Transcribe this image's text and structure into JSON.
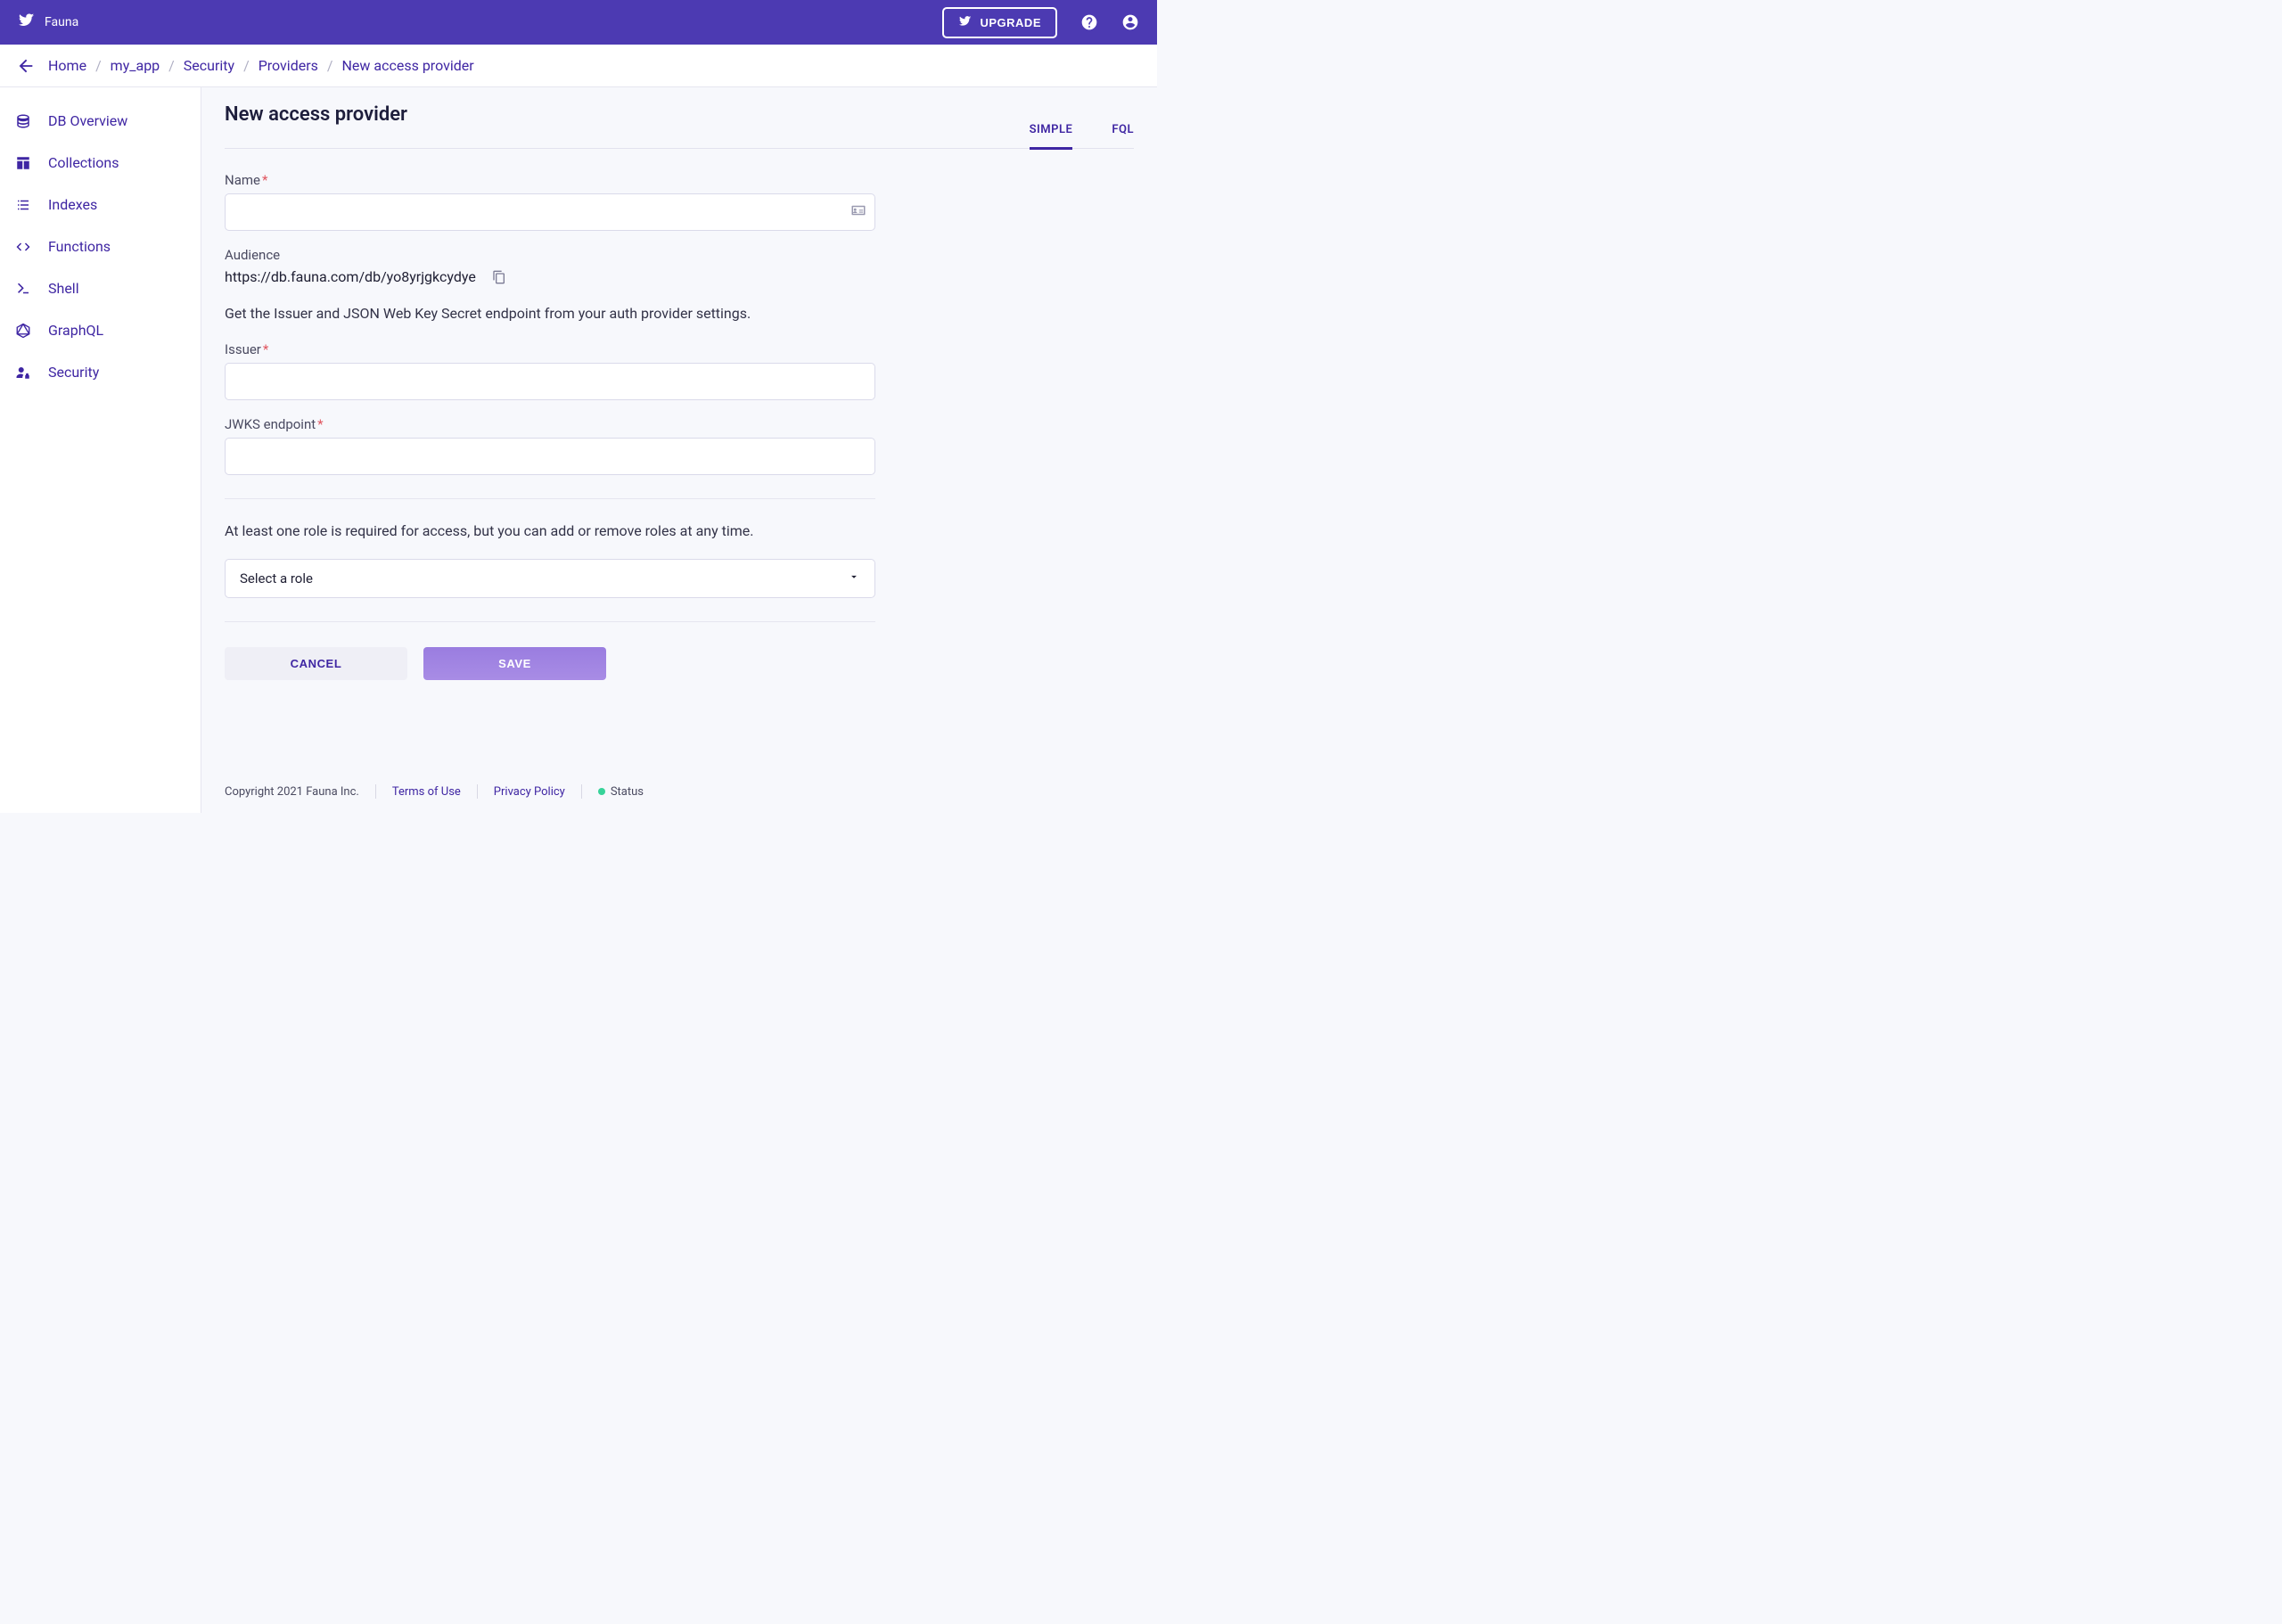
{
  "topbar": {
    "brand": "Fauna",
    "upgrade_label": "UPGRADE"
  },
  "breadcrumbs": [
    "Home",
    "my_app",
    "Security",
    "Providers",
    "New access provider"
  ],
  "sidebar": {
    "items": [
      {
        "label": "DB Overview"
      },
      {
        "label": "Collections"
      },
      {
        "label": "Indexes"
      },
      {
        "label": "Functions"
      },
      {
        "label": "Shell"
      },
      {
        "label": "GraphQL"
      },
      {
        "label": "Security"
      }
    ]
  },
  "page": {
    "title": "New access provider",
    "tabs": {
      "simple": "SIMPLE",
      "fql": "FQL"
    },
    "name_label": "Name",
    "audience_label": "Audience",
    "audience_value": "https://db.fauna.com/db/yo8yrjgkcydye",
    "issuer_helper": "Get the Issuer and JSON Web Key Secret endpoint from your auth provider settings.",
    "issuer_label": "Issuer",
    "jwks_label": "JWKS endpoint",
    "roles_helper": "At least one role is required for access, but you can add or remove roles at any time.",
    "select_placeholder": "Select a role",
    "cancel_label": "CANCEL",
    "save_label": "SAVE"
  },
  "footer": {
    "copyright": "Copyright 2021 Fauna Inc.",
    "terms": "Terms of Use",
    "privacy": "Privacy Policy",
    "status": "Status"
  }
}
